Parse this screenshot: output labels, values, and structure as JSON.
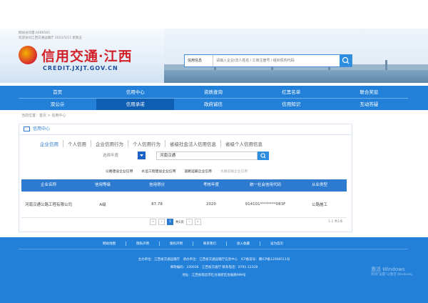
{
  "top": {
    "visits": "网站访问量:4486565",
    "welcome": "欢迎访问江西交通运输厅 2022/5/11 星期五"
  },
  "logo": {
    "title": "信用交通·江西",
    "subtitle": "CREDIT.JXJT.GOV.CN"
  },
  "search": {
    "select": "信用信息",
    "placeholder": "请输入企业/法人姓名 / 工商注册号 / 组织机构代码"
  },
  "nav": {
    "row1": [
      "首页",
      "信用中心",
      "资质查询",
      "红黑名单",
      "联合奖惩"
    ],
    "row2": [
      "双公示",
      "信用承诺",
      "政府诚信",
      "信用知识",
      "互动答疑"
    ]
  },
  "breadcrumb": "当前位置：首页 > 信用中心",
  "panel_title": "信用中心",
  "tabs": [
    "企业信用",
    "个人信用",
    "企业信用行为",
    "个人信用行为",
    "省级社会法人信用信息",
    "省级个人信用信息"
  ],
  "filters": {
    "year": "选择年度",
    "keyword": "河南汉通"
  },
  "categories": [
    "公路建设企业信用",
    "水运工程建设企业信用",
    "道路运输企业信用",
    "水路运输企业信用"
  ],
  "table": {
    "headers": [
      "企业名称",
      "信用等级",
      "信用得分",
      "考核年度",
      "统一社会信用代码",
      "从业类型"
    ],
    "rows": [
      [
        "河南汉通公路工程有限公司",
        "A级",
        "87.78",
        "2020",
        "914101********083F",
        "公路施工"
      ]
    ]
  },
  "pager": {
    "current": "1",
    "of": "共1页",
    "total": "1-1 共1条"
  },
  "footer": {
    "links": [
      "网站地图",
      "隐私声明",
      "版权声明",
      "联系我们",
      "加入收藏",
      "设为首页"
    ],
    "sponsor": "主办单位：江西省交通运输厅　承办单位：江西省交通运输厅信息中心　ICP备案号：赣ICP备12008511号",
    "contact": "邮政编码：330036　江西省交通厅 联系电话：0791-12328",
    "address": "地址：江西省南昌市红谷滩新区会展路999号"
  },
  "watermark": {
    "line1": "激活 Windows",
    "line2": "转到\"设置\"以激活 Windows。"
  },
  "colors": {
    "brand_blue": "#2380d8",
    "title_red": "#d22128"
  }
}
